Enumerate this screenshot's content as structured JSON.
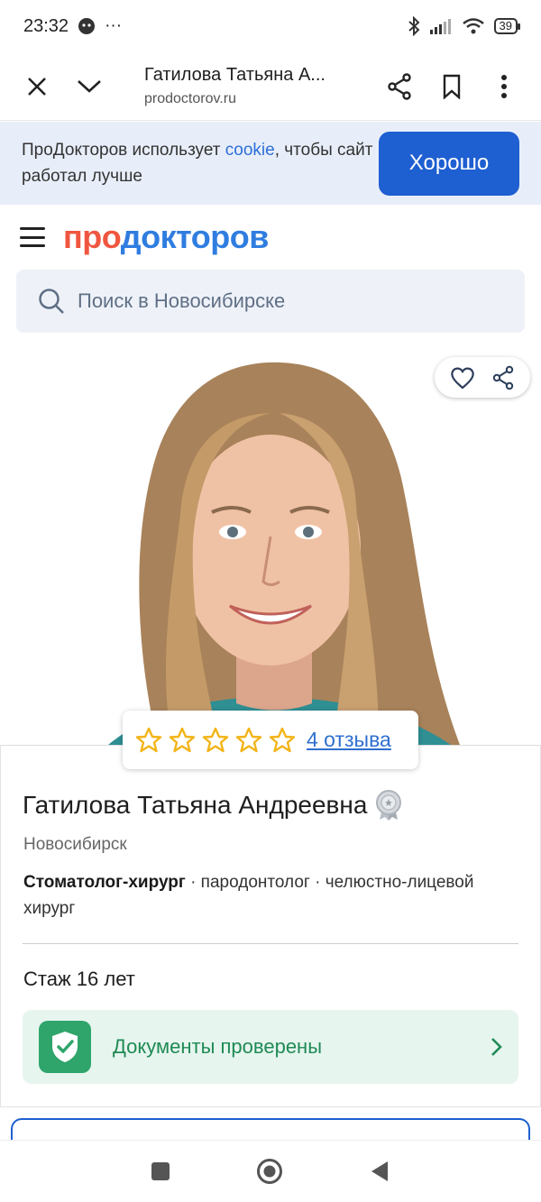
{
  "status_bar": {
    "time": "23:32",
    "notif_dots": "···",
    "battery": "39"
  },
  "browser": {
    "page_title": "Гатилова Татьяна А...",
    "url": "prodoctorov.ru",
    "icons": [
      "close-icon",
      "chevron-down-icon",
      "share-icon",
      "bookmark-icon",
      "more-vert-icon"
    ]
  },
  "cookie_banner": {
    "text_before": "ПроДокторов использует ",
    "link": "cookie",
    "text_after": ", чтобы сайт работал лучше",
    "button": "Хорошо"
  },
  "header": {
    "logo_part1": "про",
    "logo_part2": "докторов",
    "logo_colors": {
      "part1": "#f0563f",
      "part2": "#2f7de0"
    }
  },
  "search": {
    "placeholder": "Поиск в Новосибирске"
  },
  "doctor": {
    "rating_stars": 5,
    "reviews": "4 отзыва",
    "name": "Гатилова Татьяна Андреевна",
    "city": "Новосибирск",
    "spec_primary": "Стоматолог-хирург",
    "spec_rest": " · пародонтолог · челюстно-лицевой хирург",
    "experience": "Стаж 16 лет",
    "docs_verified": "Документы проверены"
  },
  "colors": {
    "accent": "#1e5fd1",
    "star": "#f2b418",
    "verified_green": "#2fa56b"
  }
}
